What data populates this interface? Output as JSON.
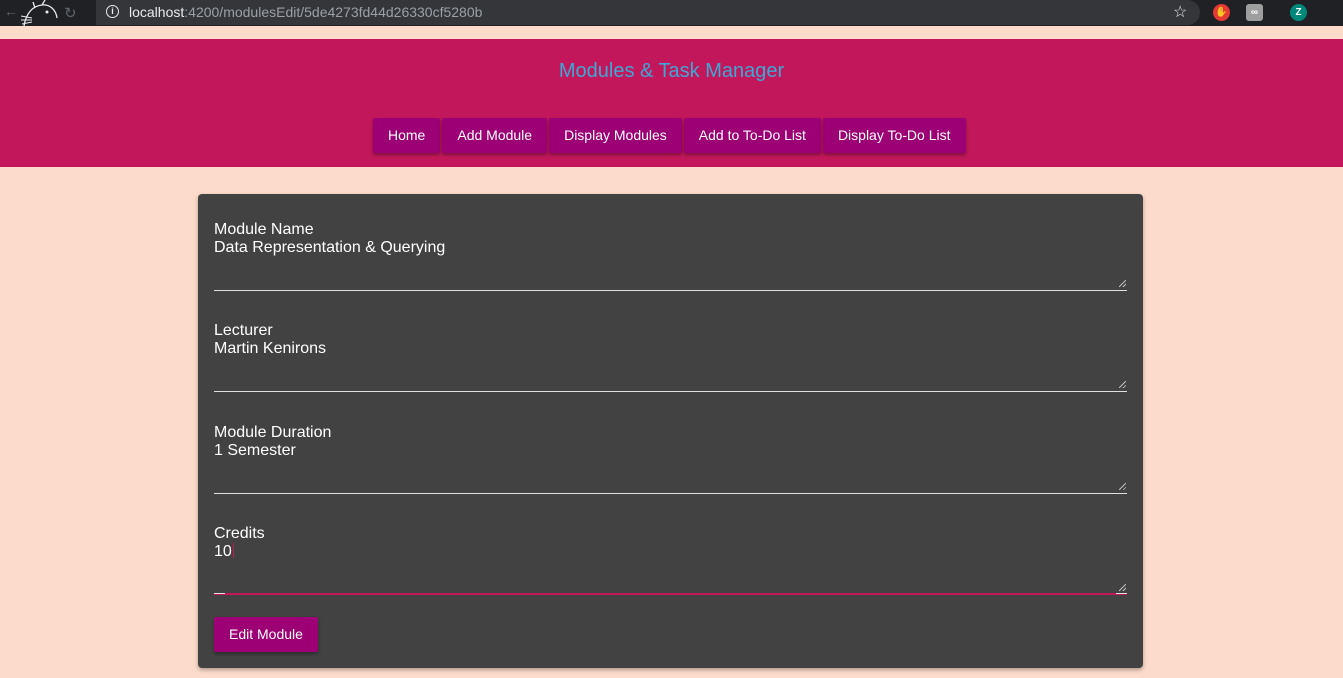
{
  "browser": {
    "url_host": "localhost",
    "url_path": ":4200/modulesEdit/5de4273fd44d26330cf5280b",
    "avatar_letter": "Z",
    "icons": [
      "back-icon",
      "mascot-logo-icon",
      "reload-icon",
      "info-icon",
      "bookmark-star-icon",
      "adblock-extension-icon",
      "extension-icon",
      "profile-avatar-icon"
    ]
  },
  "header": {
    "title": "Modules & Task Manager",
    "nav": [
      {
        "label": "Home"
      },
      {
        "label": "Add Module"
      },
      {
        "label": "Display Modules"
      },
      {
        "label": "Add to To-Do List"
      },
      {
        "label": "Display To-Do List"
      }
    ]
  },
  "form": {
    "fields": [
      {
        "label": "Module Name",
        "value": "Data Representation & Querying"
      },
      {
        "label": "Lecturer",
        "value": "Martin Kenirons"
      },
      {
        "label": "Module Duration",
        "value": "1 Semester"
      },
      {
        "label": "Credits",
        "value": "10"
      }
    ],
    "submit_label": "Edit Module"
  },
  "colors": {
    "page_background": "#fddbca",
    "header_background": "#c2185b",
    "title_color": "#3ea7d6",
    "button_background": "#9c0074",
    "card_background": "#424242"
  }
}
